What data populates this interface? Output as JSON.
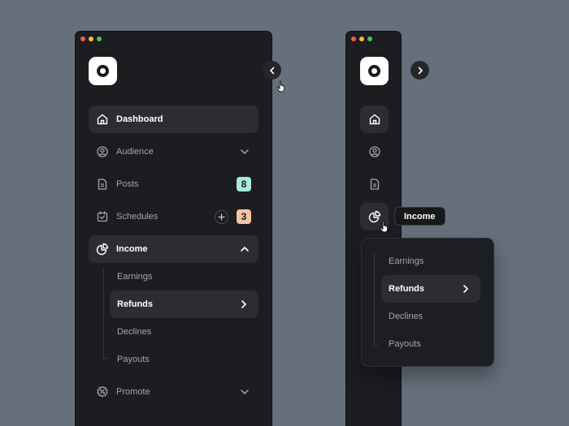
{
  "colors": {
    "background": "#66707c",
    "window": "#1c1d20",
    "active_item": "#2b2d31",
    "badge_green": "#a6ecd8",
    "badge_orange": "#f6c4a0",
    "traffic_red": "#ee5f57",
    "traffic_yellow": "#f7bd2f",
    "traffic_green": "#3fc94d"
  },
  "expanded_sidebar": {
    "collapse_button_icon": "chevron-left-icon",
    "nav": [
      {
        "label": "Dashboard",
        "icon": "home-icon",
        "active": true
      },
      {
        "label": "Audience",
        "icon": "user-circle-icon",
        "trailing": "chevron-down-icon"
      },
      {
        "label": "Posts",
        "icon": "document-icon",
        "badge": "8"
      },
      {
        "label": "Schedules",
        "icon": "calendar-check-icon",
        "badge": "3",
        "action_icon": "plus-icon"
      },
      {
        "label": "Income",
        "icon": "pie-chart-icon",
        "active": true,
        "trailing": "chevron-up-icon"
      },
      {
        "label": "Promote",
        "icon": "percent-badge-icon",
        "trailing": "chevron-down-icon"
      }
    ],
    "income_submenu": [
      {
        "label": "Earnings"
      },
      {
        "label": "Refunds",
        "active": true,
        "trailing": "chevron-right-icon"
      },
      {
        "label": "Declines"
      },
      {
        "label": "Payouts"
      }
    ]
  },
  "collapsed_sidebar": {
    "expand_button_icon": "chevron-right-icon",
    "icons": [
      "home-icon",
      "user-circle-icon",
      "document-icon",
      "pie-chart-icon"
    ],
    "tooltip": "Income",
    "flyout": [
      {
        "label": "Earnings"
      },
      {
        "label": "Refunds",
        "active": true,
        "trailing": "chevron-right-icon"
      },
      {
        "label": "Declines"
      },
      {
        "label": "Payouts"
      }
    ]
  }
}
